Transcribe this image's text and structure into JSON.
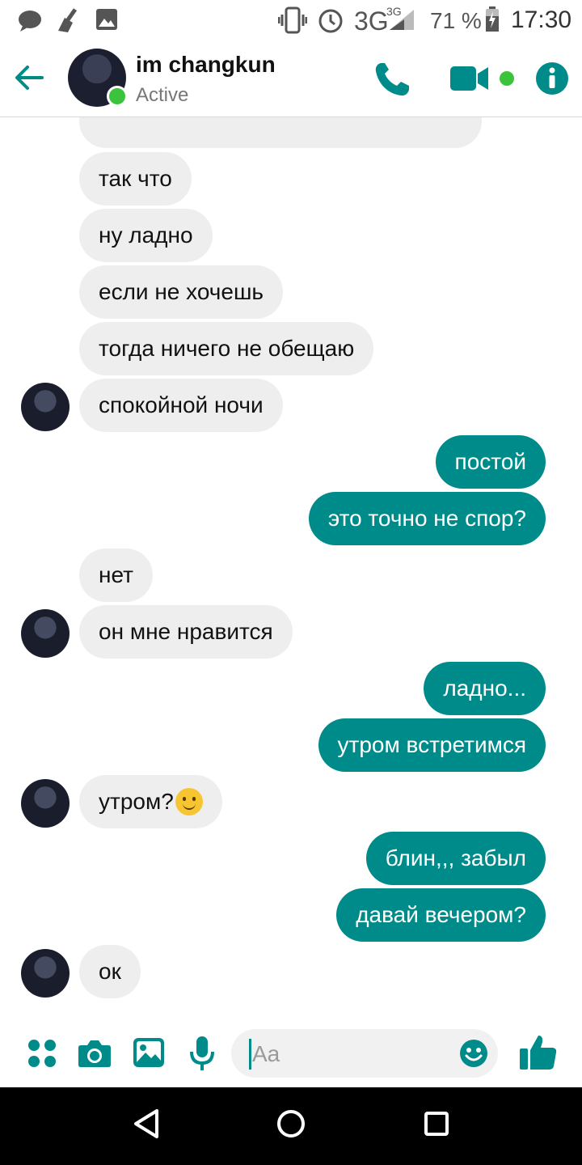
{
  "status_bar": {
    "icons": [
      "chat-bubble-icon",
      "broom-icon",
      "image-icon",
      "vibrate-icon",
      "alarm-icon",
      "signal-icon",
      "battery-icon"
    ],
    "network": "3G",
    "network_small": "3G",
    "battery": "71 %",
    "time": "17:30"
  },
  "header": {
    "contact_name": "im changkun",
    "status": "Active",
    "accent": "#008b8b",
    "online_color": "#3cc33c",
    "icons": [
      "back-arrow-icon",
      "phone-icon",
      "video-camera-icon",
      "info-icon"
    ]
  },
  "messages": [
    {
      "from": "contact",
      "text": "так что"
    },
    {
      "from": "contact",
      "text": "ну ладно"
    },
    {
      "from": "contact",
      "text": "если не хочешь"
    },
    {
      "from": "contact",
      "text": "тогда ничего не обещаю"
    },
    {
      "from": "contact",
      "text": "спокойной ночи"
    },
    {
      "from": "me",
      "text": "постой"
    },
    {
      "from": "me",
      "text": "это точно не спор?"
    },
    {
      "from": "contact",
      "text": "нет"
    },
    {
      "from": "contact",
      "text": "он мне нравится"
    },
    {
      "from": "me",
      "text": "ладно..."
    },
    {
      "from": "me",
      "text": "утром встретимся"
    },
    {
      "from": "contact",
      "text": "утром?",
      "emoji": "slightly-smiling-face"
    },
    {
      "from": "me",
      "text": "блин,,, забыл"
    },
    {
      "from": "me",
      "text": "давай вечером?"
    },
    {
      "from": "contact",
      "text": "ок"
    }
  ],
  "composer": {
    "placeholder": "Aa",
    "icons": [
      "apps-grid-icon",
      "camera-icon",
      "gallery-icon",
      "microphone-icon",
      "emoji-icon",
      "thumbs-up-icon"
    ]
  },
  "nav_bar": {
    "icons": [
      "back-triangle-icon",
      "home-circle-icon",
      "recents-square-icon"
    ]
  }
}
